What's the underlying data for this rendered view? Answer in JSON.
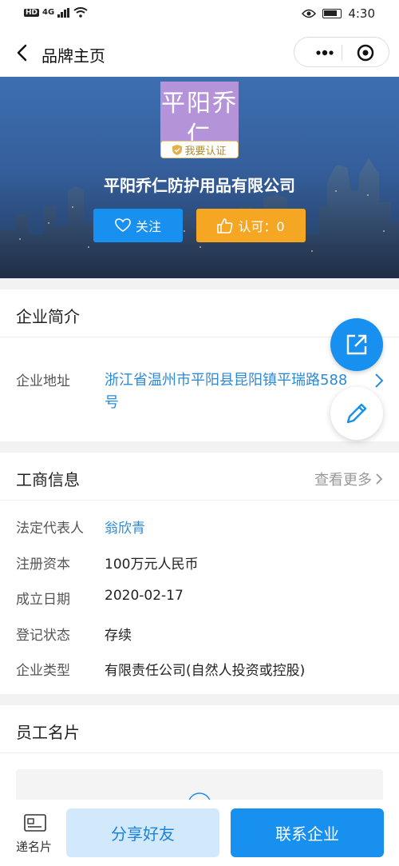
{
  "status": {
    "network": "HD",
    "signal": "4G",
    "time": "4:30"
  },
  "nav": {
    "title": "品牌主页"
  },
  "hero": {
    "logo_text": "平阳乔仁",
    "badge": "我要认证",
    "company_name": "平阳乔仁防护用品有限公司",
    "follow_label": "关注",
    "like_label": "认可：0"
  },
  "intro": {
    "title": "企业简介",
    "address_label": "企业地址",
    "address_value": "浙江省温州市平阳县昆阳镇平瑞路588号"
  },
  "business": {
    "title": "工商信息",
    "more": "查看更多",
    "rows": [
      {
        "label": "法定代表人",
        "value": "翁欣青"
      },
      {
        "label": "注册资本",
        "value": "100万元人民币"
      },
      {
        "label": "成立日期",
        "value": "2020-02-17"
      },
      {
        "label": "登记状态",
        "value": "存续"
      },
      {
        "label": "企业类型",
        "value": "有限责任公司(自然人投资或控股)"
      }
    ]
  },
  "staff": {
    "title": "员工名片"
  },
  "bottom": {
    "card_label": "递名片",
    "share_label": "分享好友",
    "contact_label": "联系企业"
  },
  "colors": {
    "primary": "#1890f0",
    "accent": "#f5a623",
    "link": "#2d8ad6",
    "logo_bg": "#b493d8"
  }
}
